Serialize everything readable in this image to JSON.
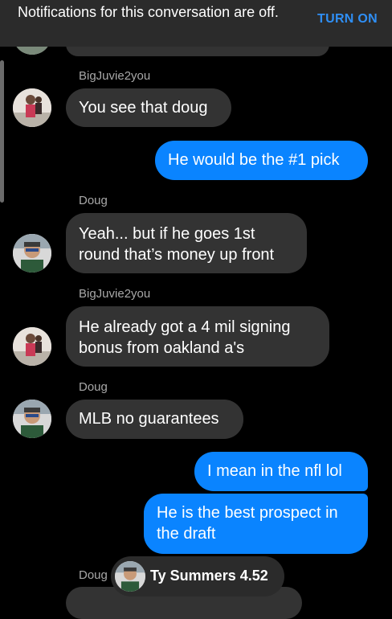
{
  "banner": {
    "message": "Notifications for this conversation are off.",
    "action_label": "TURN ON"
  },
  "messages": [
    {
      "sender": "BigJuvie2you",
      "text": "You see that doug"
    },
    {
      "sender": "me",
      "text": "He would be the #1 pick"
    },
    {
      "sender": "Doug",
      "text": "Yeah... but if he goes 1st round that’s money up front"
    },
    {
      "sender": "BigJuvie2you",
      "text": "He already got a 4 mil signing bonus from oakland a's"
    },
    {
      "sender": "Doug",
      "text": "MLB no guarantees"
    },
    {
      "sender": "me",
      "text": "I mean in the nfl lol"
    },
    {
      "sender": "me",
      "text": "He is the best prospect in the draft"
    },
    {
      "sender": "Doug",
      "text": ""
    }
  ],
  "names": {
    "bigjuvie": "BigJuvie2you",
    "doug": "Doug"
  },
  "chat_head": {
    "label": "Ty Summers 4.52",
    "icon": "profile-avatar-icon"
  },
  "colors": {
    "background": "#000000",
    "incoming_bubble": "#333333",
    "outgoing_bubble": "#0a84ff",
    "accent": "#2f8ff5"
  }
}
